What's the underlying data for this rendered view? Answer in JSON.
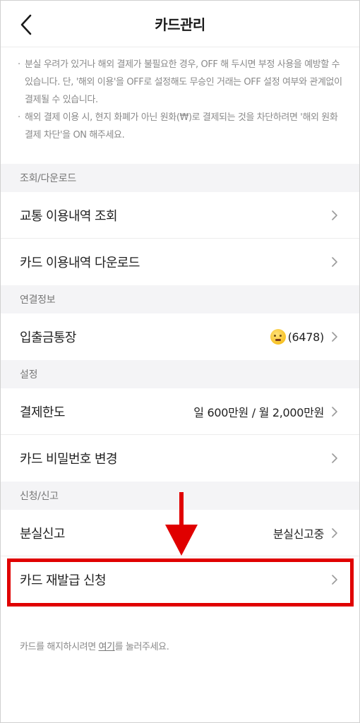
{
  "header": {
    "title": "카드관리"
  },
  "notice": {
    "items": [
      "분실 우려가 있거나 해외 결제가 불필요한 경우, OFF 해 두시면 부정 사용을 예방할 수 있습니다. 단, '해외 이용'을 OFF로 설정해도 무승인 거래는 OFF 설정 여부와 관계없이 결제될 수 있습니다.",
      "해외 결제 이용 시, 현지 화폐가 아닌 원화(₩)로 결제되는 것을 차단하려면 '해외 원화 결제 차단'을 ON 해주세요."
    ]
  },
  "sections": {
    "lookup": {
      "title": "조회/다운로드",
      "items": [
        {
          "label": "교통 이용내역 조회"
        },
        {
          "label": "카드 이용내역 다운로드"
        }
      ]
    },
    "linked": {
      "title": "연결정보",
      "items": [
        {
          "label": "입출금통장",
          "value": "(6478)",
          "icon": "thinking-face-emoji"
        }
      ]
    },
    "settings": {
      "title": "설정",
      "items": [
        {
          "label": "결제한도",
          "value": "일 600만원 / 월 2,000만원"
        },
        {
          "label": "카드 비밀번호 변경"
        }
      ]
    },
    "apply": {
      "title": "신청/신고",
      "items": [
        {
          "label": "분실신고",
          "value": "분실신고중"
        },
        {
          "label": "카드 재발급 신청"
        }
      ]
    }
  },
  "footer": {
    "prefix": "카드를 해지하시려면 ",
    "link": "여기",
    "suffix": "를 눌러주세요."
  },
  "colors": {
    "highlight": "#e00000",
    "section_bg": "#f4f4f6"
  }
}
